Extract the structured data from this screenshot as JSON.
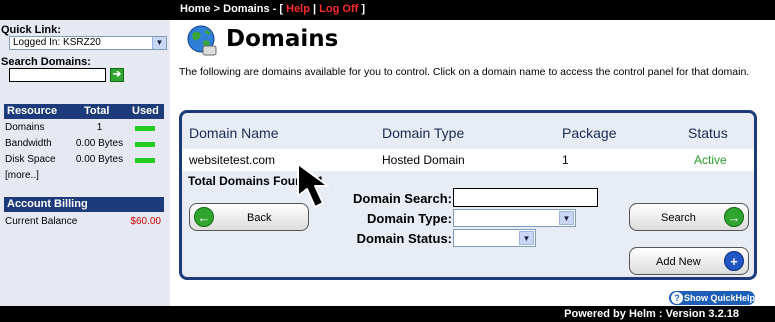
{
  "breadcrumb": {
    "home": "Home",
    "sep1": ">",
    "domains": "Domains",
    "sep2": "-",
    "open_bracket": "[",
    "help": "Help",
    "pipe": "|",
    "logoff": "Log Off",
    "close_bracket": "]"
  },
  "sidebar": {
    "quick_link_label": "Quick Link:",
    "quick_link_value": "Logged In: KSRZ20",
    "search_label": "Search Domains:",
    "search_value": "",
    "resources": {
      "headers": [
        "Resource",
        "Total",
        "Used"
      ],
      "rows": [
        {
          "name": "Domains",
          "total": "1"
        },
        {
          "name": "Bandwidth",
          "total": "0.00 Bytes"
        },
        {
          "name": "Disk Space",
          "total": "0.00 Bytes"
        }
      ],
      "more": "[more..]"
    },
    "billing": {
      "title": "Account Billing",
      "label": "Current Balance",
      "value": "$60.00"
    }
  },
  "main": {
    "title": "Domains",
    "intro": "The following are domains available for you to control. Click on a domain name to access the control panel for that domain.",
    "table": {
      "columns": [
        "Domain Name",
        "Domain Type",
        "Package",
        "Status"
      ],
      "rows": [
        {
          "name": "websitetest.com",
          "type": "Hosted Domain",
          "package": "1",
          "status": "Active"
        }
      ],
      "total_label": "Total Domains Found: 1"
    },
    "filters": {
      "search_label": "Domain Search:",
      "type_label": "Domain Type:",
      "status_label": "Domain Status:",
      "search_value": "",
      "type_value": "",
      "status_value": ""
    },
    "buttons": {
      "back": "Back",
      "search": "Search",
      "add_new": "Add New"
    },
    "quick_help": "Show QuickHelp"
  },
  "footer": {
    "text": "Powered by Helm  :  Version 3.2.18"
  },
  "colors": {
    "nav_blue": "#1d3b7a",
    "link_red": "#ff2a2a",
    "active_green": "#2b9a2b",
    "usage_bar": "#22cc22"
  }
}
